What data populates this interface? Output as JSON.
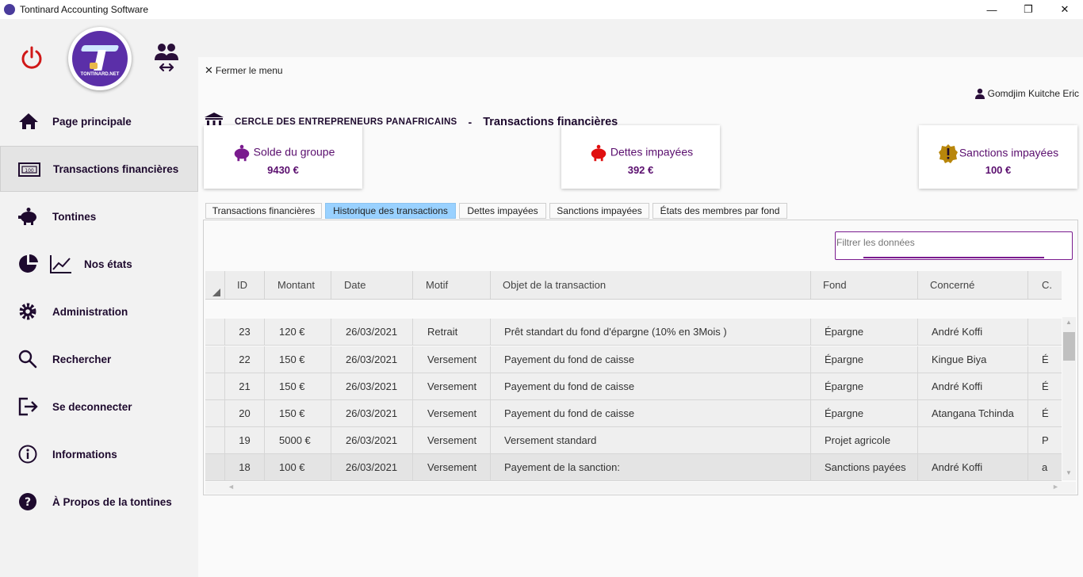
{
  "window": {
    "title": "Tontinard Accounting Software",
    "minimize": "—",
    "maximize": "❐",
    "close": "✕"
  },
  "sidebar": {
    "logo_text": "TONTINARD.NET",
    "items": [
      {
        "label": "Page principale",
        "icon": "home-icon"
      },
      {
        "label": "Transactions financières",
        "icon": "banknote-icon"
      },
      {
        "label": "Tontines",
        "icon": "piggy-bank-icon"
      },
      {
        "label": "Nos états",
        "icon": "chart-icon"
      },
      {
        "label": "Administration",
        "icon": "gear-icon"
      },
      {
        "label": "Rechercher",
        "icon": "search-icon"
      },
      {
        "label": "Se deconnecter",
        "icon": "logout-icon"
      },
      {
        "label": "Informations",
        "icon": "info-icon"
      },
      {
        "label": "À Propos de la  tontines",
        "icon": "help-icon"
      }
    ]
  },
  "header": {
    "close_menu": "Fermer le menu",
    "user_name": "Gomdjim Kuitche Eric",
    "org_name": "CERCLE DES ENTREPRENEURS PANAFRICAINS",
    "separator": "-",
    "page_title": "Transactions financières"
  },
  "cards": [
    {
      "title": "Solde du groupe",
      "value": "9430 €"
    },
    {
      "title": "Dettes impayées",
      "value": "392 €"
    },
    {
      "title": "Sanctions impayées",
      "value": "100 €"
    }
  ],
  "tabs": [
    {
      "label": "Transactions financières"
    },
    {
      "label": "Historique des transactions"
    },
    {
      "label": "Dettes impayées"
    },
    {
      "label": "Sanctions impayées"
    },
    {
      "label": "États des membres par fond"
    }
  ],
  "active_tab": "Historique des transactions",
  "filter": {
    "placeholder": "Filtrer les données"
  },
  "table": {
    "columns": [
      "ID",
      "Montant",
      "Date",
      "Motif",
      "Objet de la transaction",
      "Fond",
      "Concerné",
      "C."
    ],
    "rows": [
      [
        "23",
        "120 €",
        "26/03/2021",
        "Retrait",
        "Prêt standart du fond d'épargne (10% en 3Mois )",
        "Épargne",
        "André Koffi",
        ""
      ],
      [
        "22",
        "150 €",
        "26/03/2021",
        "Versement",
        "Payement du fond de caisse",
        "Épargne",
        "Kingue Biya",
        "É"
      ],
      [
        "21",
        "150 €",
        "26/03/2021",
        "Versement",
        "Payement du fond de caisse",
        "Épargne",
        "André Koffi",
        "É"
      ],
      [
        "20",
        "150 €",
        "26/03/2021",
        "Versement",
        "Payement du fond de caisse",
        "Épargne",
        "Atangana Tchinda",
        "É"
      ],
      [
        "19",
        "5000 €",
        "26/03/2021",
        "Versement",
        "Versement standard",
        "Projet agricole",
        "",
        "P"
      ],
      [
        "18",
        "100 €",
        "26/03/2021",
        "Versement",
        "Payement de la sanction:",
        "Sanctions payées",
        "André Koffi",
        "a"
      ]
    ]
  },
  "colors": {
    "accent": "#5a0e6e",
    "power": "#d01818",
    "active_tab": "#99d1ff",
    "warning": "#b8860b",
    "danger": "#e01010"
  }
}
